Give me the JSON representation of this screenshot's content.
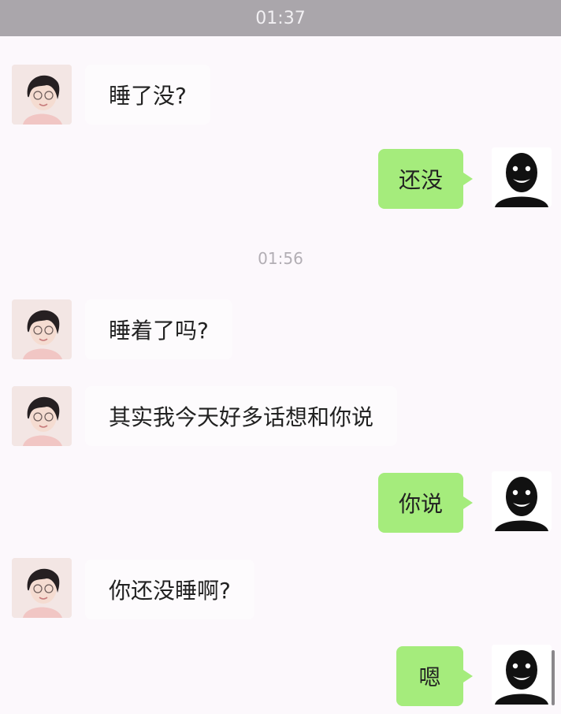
{
  "top_timestamp": "01:37",
  "mid_timestamp": "01:56",
  "messages": [
    {
      "side": "in",
      "text": "睡了没?"
    },
    {
      "side": "out",
      "text": "还没"
    },
    {
      "side": "in",
      "text": "睡着了吗?"
    },
    {
      "side": "in",
      "text": "其实我今天好多话想和你说"
    },
    {
      "side": "out",
      "text": "你说"
    },
    {
      "side": "in",
      "text": "你还没睡啊?"
    },
    {
      "side": "out",
      "text": "嗯"
    }
  ],
  "colors": {
    "background": "#fcf8fc",
    "top_bar": "#aaa6ab",
    "incoming_bubble": "#fdfbfd",
    "outgoing_bubble": "#a5ec7c",
    "timestamp": "#b2aeb4"
  },
  "icons": {
    "her_avatar": "girl-portrait-avatar",
    "my_avatar": "grinning-shadow-figure-avatar"
  }
}
